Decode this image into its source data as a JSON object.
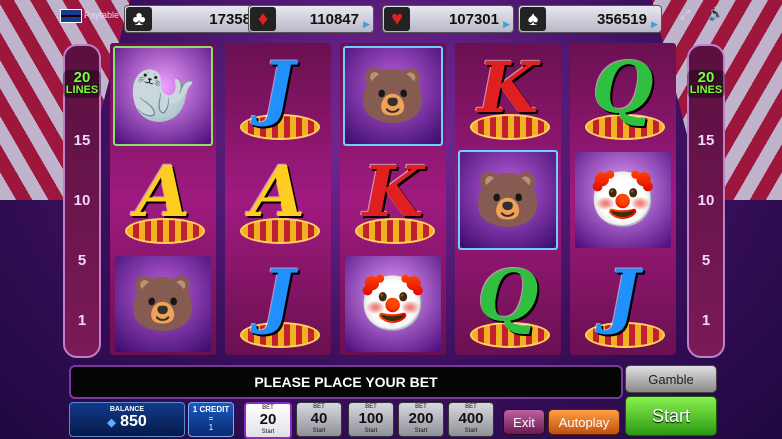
{
  "header": {
    "paytable_label": "Paytable",
    "jackpots": [
      {
        "suit": "clubs",
        "symbol": "♣",
        "value": "17358",
        "color": "#ffffff"
      },
      {
        "suit": "diamonds",
        "symbol": "♦",
        "value": "110847",
        "color": "#e02020"
      },
      {
        "suit": "hearts",
        "symbol": "♥",
        "value": "107301",
        "color": "#e02020"
      },
      {
        "suit": "spades",
        "symbol": "♠",
        "value": "356519",
        "color": "#ffffff"
      }
    ],
    "icons": [
      "fullscreen-icon",
      "volume-icon"
    ]
  },
  "lines": {
    "count": "20",
    "label": "LINES",
    "markers": [
      "15",
      "10",
      "5",
      "1"
    ]
  },
  "reels": [
    [
      "seal",
      "A",
      "bear"
    ],
    [
      "J",
      "A",
      "J"
    ],
    [
      "bear",
      "K",
      "clown"
    ],
    [
      "K",
      "bear",
      "Q"
    ],
    [
      "Q",
      "clown",
      "J"
    ]
  ],
  "message": "PLEASE PLACE YOUR BET",
  "controls": {
    "gamble_label": "Gamble",
    "start_label": "Start",
    "balance_label": "BALANCE",
    "balance_value": "850",
    "credit_label": "1 CREDIT",
    "credit_eq": "=",
    "credit_value": "1",
    "exit_label": "Exit",
    "autoplay_label": "Autoplay",
    "bets": [
      {
        "top": "BET",
        "value": "20",
        "bottom": "Start",
        "selected": true
      },
      {
        "top": "BET",
        "value": "40",
        "bottom": "Start",
        "selected": false
      },
      {
        "top": "BET",
        "value": "100",
        "bottom": "Start",
        "selected": false
      },
      {
        "top": "BET",
        "value": "200",
        "bottom": "Start",
        "selected": false
      },
      {
        "top": "BET",
        "value": "400",
        "bottom": "Start",
        "selected": false
      }
    ]
  }
}
